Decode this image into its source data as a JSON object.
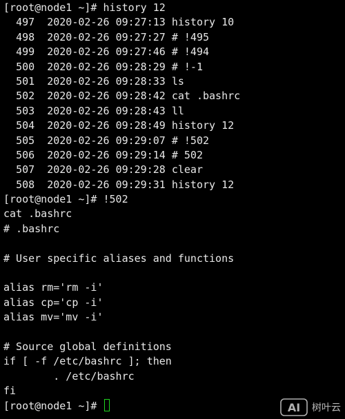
{
  "terminal": {
    "prompt1": "[root@node1 ~]# history 12",
    "history": [
      {
        "num": "497",
        "date": "2020-02-26",
        "time": "09:27:13",
        "cmd": "history 10"
      },
      {
        "num": "498",
        "date": "2020-02-26",
        "time": "09:27:27",
        "cmd": "# !495"
      },
      {
        "num": "499",
        "date": "2020-02-26",
        "time": "09:27:46",
        "cmd": "# !494"
      },
      {
        "num": "500",
        "date": "2020-02-26",
        "time": "09:28:29",
        "cmd": "# !-1"
      },
      {
        "num": "501",
        "date": "2020-02-26",
        "time": "09:28:33",
        "cmd": "ls"
      },
      {
        "num": "502",
        "date": "2020-02-26",
        "time": "09:28:42",
        "cmd": "cat .bashrc"
      },
      {
        "num": "503",
        "date": "2020-02-26",
        "time": "09:28:43",
        "cmd": "ll"
      },
      {
        "num": "504",
        "date": "2020-02-26",
        "time": "09:28:49",
        "cmd": "history 12"
      },
      {
        "num": "505",
        "date": "2020-02-26",
        "time": "09:29:07",
        "cmd": "# !502"
      },
      {
        "num": "506",
        "date": "2020-02-26",
        "time": "09:29:14",
        "cmd": "# 502"
      },
      {
        "num": "507",
        "date": "2020-02-26",
        "time": "09:29:28",
        "cmd": "clear"
      },
      {
        "num": "508",
        "date": "2020-02-26",
        "time": "09:29:31",
        "cmd": "history 12"
      }
    ],
    "prompt2": "[root@node1 ~]# !502",
    "output": [
      "cat .bashrc",
      "# .bashrc",
      "",
      "# User specific aliases and functions",
      "",
      "alias rm='rm -i'",
      "alias cp='cp -i'",
      "alias mv='mv -i'",
      "",
      "# Source global definitions",
      "if [ -f /etc/bashrc ]; then",
      "        . /etc/bashrc",
      "fi"
    ],
    "prompt3": "[root@node1 ~]# ",
    "cursor_color": "#1fd41f",
    "background": "#000000",
    "foreground": "#e8e8e8"
  },
  "watermark": {
    "logo_text": "AI",
    "text": "树叶云"
  }
}
